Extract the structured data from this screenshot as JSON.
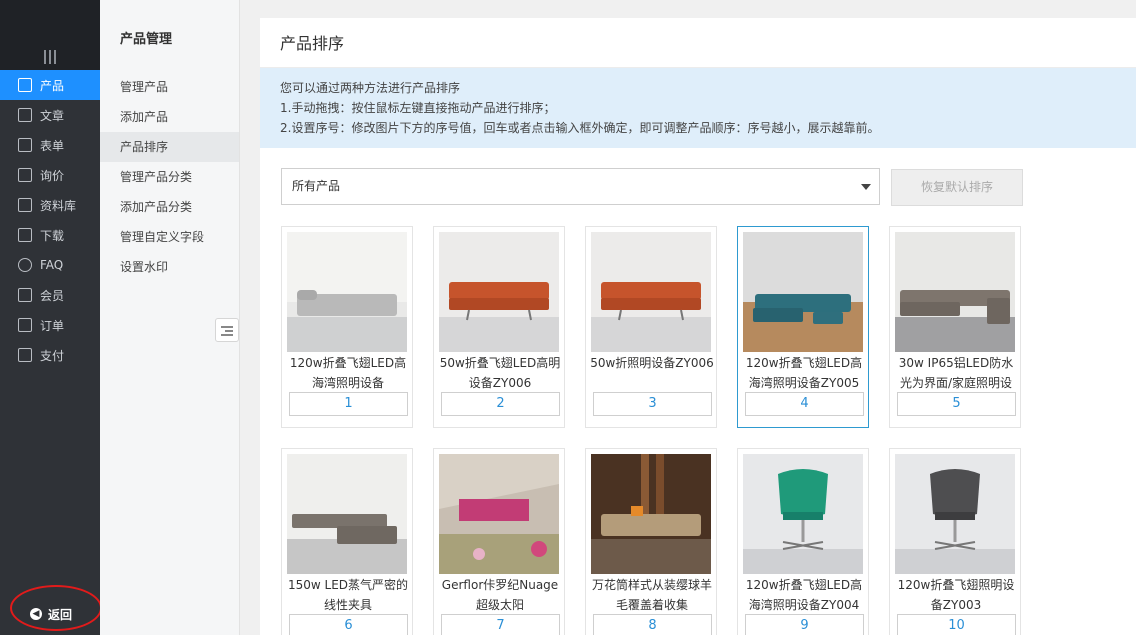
{
  "nav": {
    "items": [
      {
        "label": "产品",
        "icon": "grid-icon",
        "active": true
      },
      {
        "label": "文章",
        "icon": "article-icon"
      },
      {
        "label": "表单",
        "icon": "form-icon"
      },
      {
        "label": "询价",
        "icon": "inquiry-icon"
      },
      {
        "label": "资料库",
        "icon": "database-icon"
      },
      {
        "label": "下载",
        "icon": "download-icon"
      },
      {
        "label": "FAQ",
        "icon": "faq-icon"
      },
      {
        "label": "会员",
        "icon": "member-icon"
      },
      {
        "label": "订单",
        "icon": "order-icon"
      },
      {
        "label": "支付",
        "icon": "payment-icon"
      }
    ],
    "back_label": "返回"
  },
  "subnav": {
    "title": "产品管理",
    "items": [
      {
        "label": "管理产品"
      },
      {
        "label": "添加产品"
      },
      {
        "label": "产品排序",
        "active": true
      },
      {
        "label": "管理产品分类"
      },
      {
        "label": "添加产品分类"
      },
      {
        "label": "管理自定义字段"
      },
      {
        "label": "设置水印"
      }
    ]
  },
  "main": {
    "title": "产品排序",
    "tips": [
      "您可以通过两种方法进行产品排序",
      "1.手动拖拽：按住鼠标左键直接拖动产品进行排序；",
      "2.设置序号：修改图片下方的序号值，回车或者点击输入框外确定，即可调整产品顺序：序号越小，展示越靠前。"
    ],
    "filter_selected": "所有产品",
    "reset_label": "恢复默认排序",
    "products": [
      {
        "name": "120w折叠飞翅LED高海湾照明设备",
        "order": "1"
      },
      {
        "name": "50w折叠飞翅LED高明设备ZY006",
        "order": "2"
      },
      {
        "name": "50w折照明设备ZY006",
        "order": "3"
      },
      {
        "name": "120w折叠飞翅LED高海湾照明设备ZY005",
        "order": "4"
      },
      {
        "name": "30w IP65铝LED防水光为界面/家庭照明设",
        "order": "5"
      },
      {
        "name": "150w LED蒸气严密的线性夹具",
        "order": "6"
      },
      {
        "name": "Gerflor佧罗纪Nuage超级太阳",
        "order": "7"
      },
      {
        "name": "万花筒样式从装缨球羊毛覆盖着收集",
        "order": "8"
      },
      {
        "name": "120w折叠飞翅LED高海湾照明设备ZY004",
        "order": "9"
      },
      {
        "name": "120w折叠飞翅照明设备ZY003",
        "order": "10"
      }
    ]
  },
  "colors": {
    "accent": "#1e90ff",
    "nav_bg": "#2f3237",
    "tips_bg": "#dfeefa",
    "annotation_red": "#e21b1b"
  }
}
